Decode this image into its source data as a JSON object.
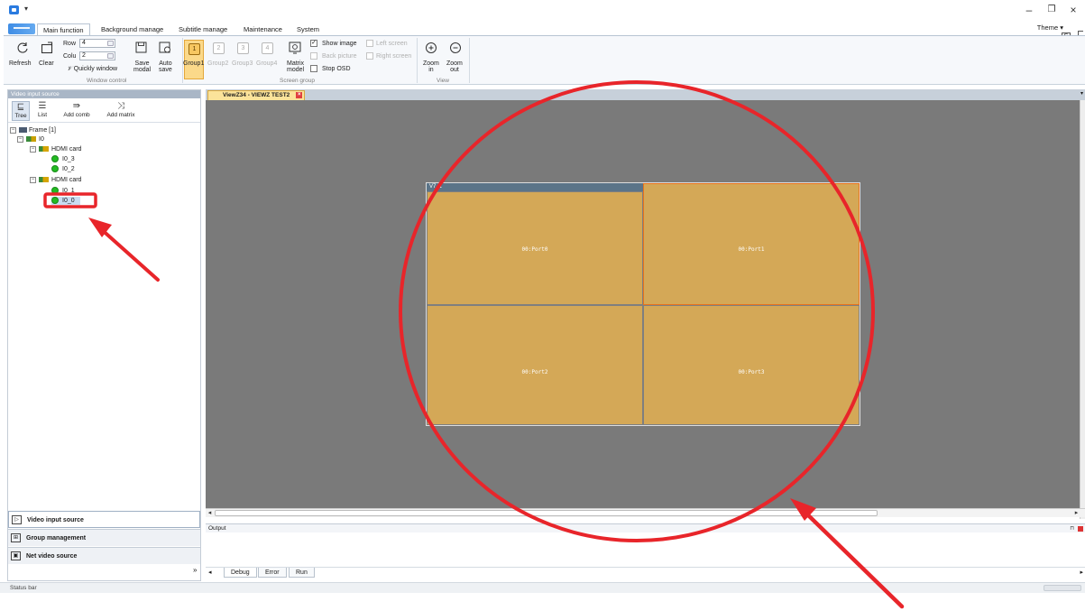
{
  "titlebar": {
    "quick_access": "▾"
  },
  "menu": {
    "tabs": [
      {
        "label": "Main function"
      },
      {
        "label": "Background manage"
      },
      {
        "label": "Subtitle manage"
      },
      {
        "label": "Maintenance"
      },
      {
        "label": "System"
      }
    ],
    "theme_label": "Theme",
    "theme_arrow": "▾",
    "theme_value": "S"
  },
  "ribbon": {
    "refresh": "Refresh",
    "clear": "Clear",
    "row_label": "Row",
    "row_value": "4",
    "col_label": "Colu",
    "col_value": "2",
    "quickly_window": "Quickly window",
    "save_line1": "Save",
    "save_line2": "modal",
    "auto_line1": "Auto",
    "auto_line2": "save",
    "window_control": "Window control",
    "groups": [
      {
        "label": "Group1",
        "num": "1"
      },
      {
        "label": "Group2",
        "num": "2"
      },
      {
        "label": "Group3",
        "num": "3"
      },
      {
        "label": "Group4",
        "num": "4"
      }
    ],
    "matrix_line1": "Matrix",
    "matrix_line2": "model",
    "show_image": "Show image",
    "back_picture": "Back picture",
    "stop_osd": "Stop OSD",
    "left_screen": "Left screen",
    "right_screen": "Right screen",
    "screen_group": "Screen group",
    "zoom_in_line1": "Zoom",
    "zoom_in_line2": "in",
    "zoom_out_line1": "Zoom",
    "zoom_out_line2": "out",
    "view": "View"
  },
  "left_panel": {
    "header": "Video input source",
    "tools": [
      {
        "label": "Tree"
      },
      {
        "label": "List"
      },
      {
        "label": "Add comb"
      },
      {
        "label": "Add matrix"
      }
    ],
    "tree": {
      "frame": "Frame [1]",
      "io": "I0",
      "card1": "HDMI card",
      "card1_items": [
        "I0_3",
        "I0_2"
      ],
      "card2": "HDMI card",
      "card2_items": [
        "I0_1",
        "I0_0"
      ]
    },
    "nav": [
      {
        "label": "Video input source"
      },
      {
        "label": "Group management"
      },
      {
        "label": "Net video source"
      }
    ],
    "more": "»"
  },
  "document": {
    "tab_label": "ViewZ34 - VIEWZ TEST2",
    "wall_title": "V7_1",
    "cells": [
      {
        "label": "00:Port0"
      },
      {
        "label": "00:Port1"
      },
      {
        "label": "00:Port2"
      },
      {
        "label": "00:Port3"
      }
    ]
  },
  "output": {
    "header": "Output",
    "tabs": [
      {
        "label": "Debug"
      },
      {
        "label": "Error"
      },
      {
        "label": "Run"
      }
    ]
  },
  "status": {
    "text": "Status bar"
  },
  "colors": {
    "canvas": "#7a7a7a",
    "cell": "#d4a857",
    "active_group": "#fbd98a",
    "annotation": "#e8252a",
    "online_dot": "#22bb22"
  }
}
